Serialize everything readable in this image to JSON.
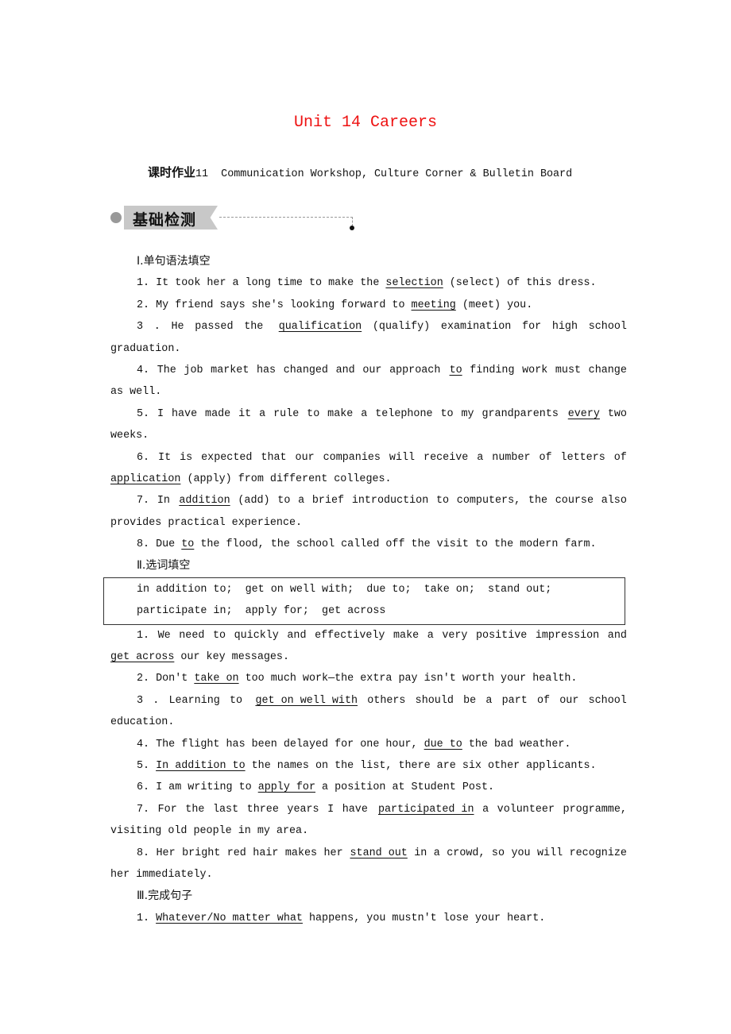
{
  "title": "Unit 14 Careers",
  "subtitle": {
    "cn": "课时作业",
    "rest": "11  Communication Workshop, Culture Corner & Bulletin Board"
  },
  "badge": "基础检测",
  "sections": [
    {
      "header": "Ⅰ.单句语法填空",
      "items": [
        [
          [
            [
              "1. It took her a long time to make the ",
              0
            ],
            [
              "selection",
              1
            ],
            [
              " (select) of this dress.",
              0
            ]
          ]
        ],
        [
          [
            [
              "2. My friend says she's looking forward to ",
              0
            ],
            [
              "meeting",
              1
            ],
            [
              " (meet) you.",
              0
            ]
          ]
        ],
        [
          [
            [
              "3 . He passed the ",
              0
            ],
            [
              "qualification",
              1
            ],
            [
              " (qualify) examination for high school",
              0
            ]
          ],
          [
            [
              "graduation.",
              0
            ]
          ]
        ],
        [
          [
            [
              "4. The job market has changed and our approach ",
              0
            ],
            [
              "to",
              1
            ],
            [
              " finding work must change",
              0
            ]
          ],
          [
            [
              "as well.",
              0
            ]
          ]
        ],
        [
          [
            [
              "5. I have made it a rule to make a telephone to my grandparents ",
              0
            ],
            [
              "every",
              1
            ],
            [
              " two",
              0
            ]
          ],
          [
            [
              "weeks.",
              0
            ]
          ]
        ],
        [
          [
            [
              "6. It is expected that our companies will receive a number of letters of",
              0
            ]
          ],
          [
            [
              "application",
              1
            ],
            [
              " (apply) from different colleges.",
              0
            ]
          ]
        ],
        [
          [
            [
              "7. In ",
              0
            ],
            [
              "addition",
              1
            ],
            [
              " (add) to a brief introduction to computers, the course also",
              0
            ]
          ],
          [
            [
              "provides practical experience.",
              0
            ]
          ]
        ],
        [
          [
            [
              "8. Due ",
              0
            ],
            [
              "to",
              1
            ],
            [
              " the flood, the school called off the visit to the modern farm.",
              0
            ]
          ]
        ]
      ]
    },
    {
      "header": "Ⅱ.选词填空",
      "box": [
        "in addition to;  get on well with;  due to;  take on;  stand out;",
        "participate in;  apply for;  get across"
      ],
      "items": [
        [
          [
            [
              "1. We need to quickly and effectively make a very positive impression and",
              0
            ]
          ],
          [
            [
              "get across",
              1
            ],
            [
              " our key messages.",
              0
            ]
          ]
        ],
        [
          [
            [
              "2. Don't ",
              0
            ],
            [
              "take on",
              1
            ],
            [
              " too much work—the extra pay isn't worth your health.",
              0
            ]
          ]
        ],
        [
          [
            [
              "3 . Learning to ",
              0
            ],
            [
              "get on well with",
              1
            ],
            [
              " others should be a part of our school",
              0
            ]
          ],
          [
            [
              "education.",
              0
            ]
          ]
        ],
        [
          [
            [
              "4. The flight has been delayed for one hour, ",
              0
            ],
            [
              "due to",
              1
            ],
            [
              " the bad weather.",
              0
            ]
          ]
        ],
        [
          [
            [
              "5. ",
              0
            ],
            [
              "In addition to",
              1
            ],
            [
              " the names on the list, there are six other applicants.",
              0
            ]
          ]
        ],
        [
          [
            [
              "6. I am writing to ",
              0
            ],
            [
              "apply for",
              1
            ],
            [
              " a position at Student Post.",
              0
            ]
          ]
        ],
        [
          [
            [
              "7. For the last three years I have ",
              0
            ],
            [
              "participated in",
              1
            ],
            [
              " a volunteer programme,",
              0
            ]
          ],
          [
            [
              "visiting old people in my area.",
              0
            ]
          ]
        ],
        [
          [
            [
              "8. Her bright red hair makes her ",
              0
            ],
            [
              "stand out",
              1
            ],
            [
              " in a crowd, so you will recognize",
              0
            ]
          ],
          [
            [
              "her immediately.",
              0
            ]
          ]
        ]
      ]
    },
    {
      "header": "Ⅲ.完成句子",
      "items": [
        [
          [
            [
              "1. ",
              0
            ],
            [
              "Whatever/No matter what",
              1
            ],
            [
              " happens, you mustn't lose your heart.",
              0
            ]
          ]
        ]
      ]
    }
  ]
}
